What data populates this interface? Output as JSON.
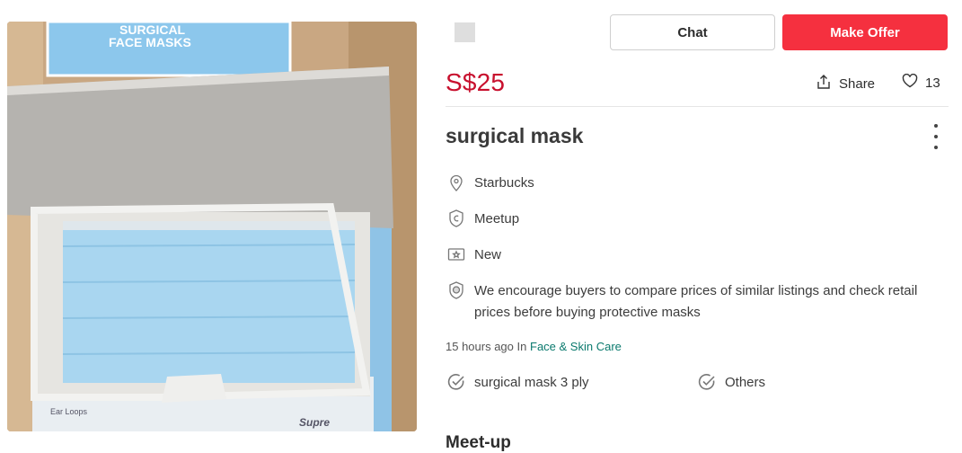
{
  "listing": {
    "price": "S$25",
    "title": "surgical mask",
    "likes": "13",
    "share_label": "Share",
    "location": "Starbucks",
    "deal_method": "Meetup",
    "condition": "New",
    "notice": "We encourage buyers to compare prices of similar listings and check retail prices before buying protective masks",
    "posted": "15 hours ago",
    "in_label": "In",
    "category": "Face & Skin Care",
    "features": [
      "surgical mask 3 ply",
      "Others"
    ],
    "section_heading": "Meet-up"
  },
  "actions": {
    "chat_label": "Chat",
    "offer_label": "Make Offer"
  },
  "photo_text": {
    "box_top_line1": "SURGICAL",
    "box_top_line2": "FACE MASKS",
    "box_bottom_label": "Ear Loops"
  },
  "colors": {
    "price": "#c8102e",
    "offer_button": "#f5303f",
    "category_link": "#0b7a6e"
  },
  "icons": [
    "location-pin-icon",
    "meetup-shield-icon",
    "condition-ticket-icon",
    "info-shield-icon",
    "share-icon",
    "heart-icon",
    "checkmark-circle-icon",
    "more-vertical-icon"
  ]
}
